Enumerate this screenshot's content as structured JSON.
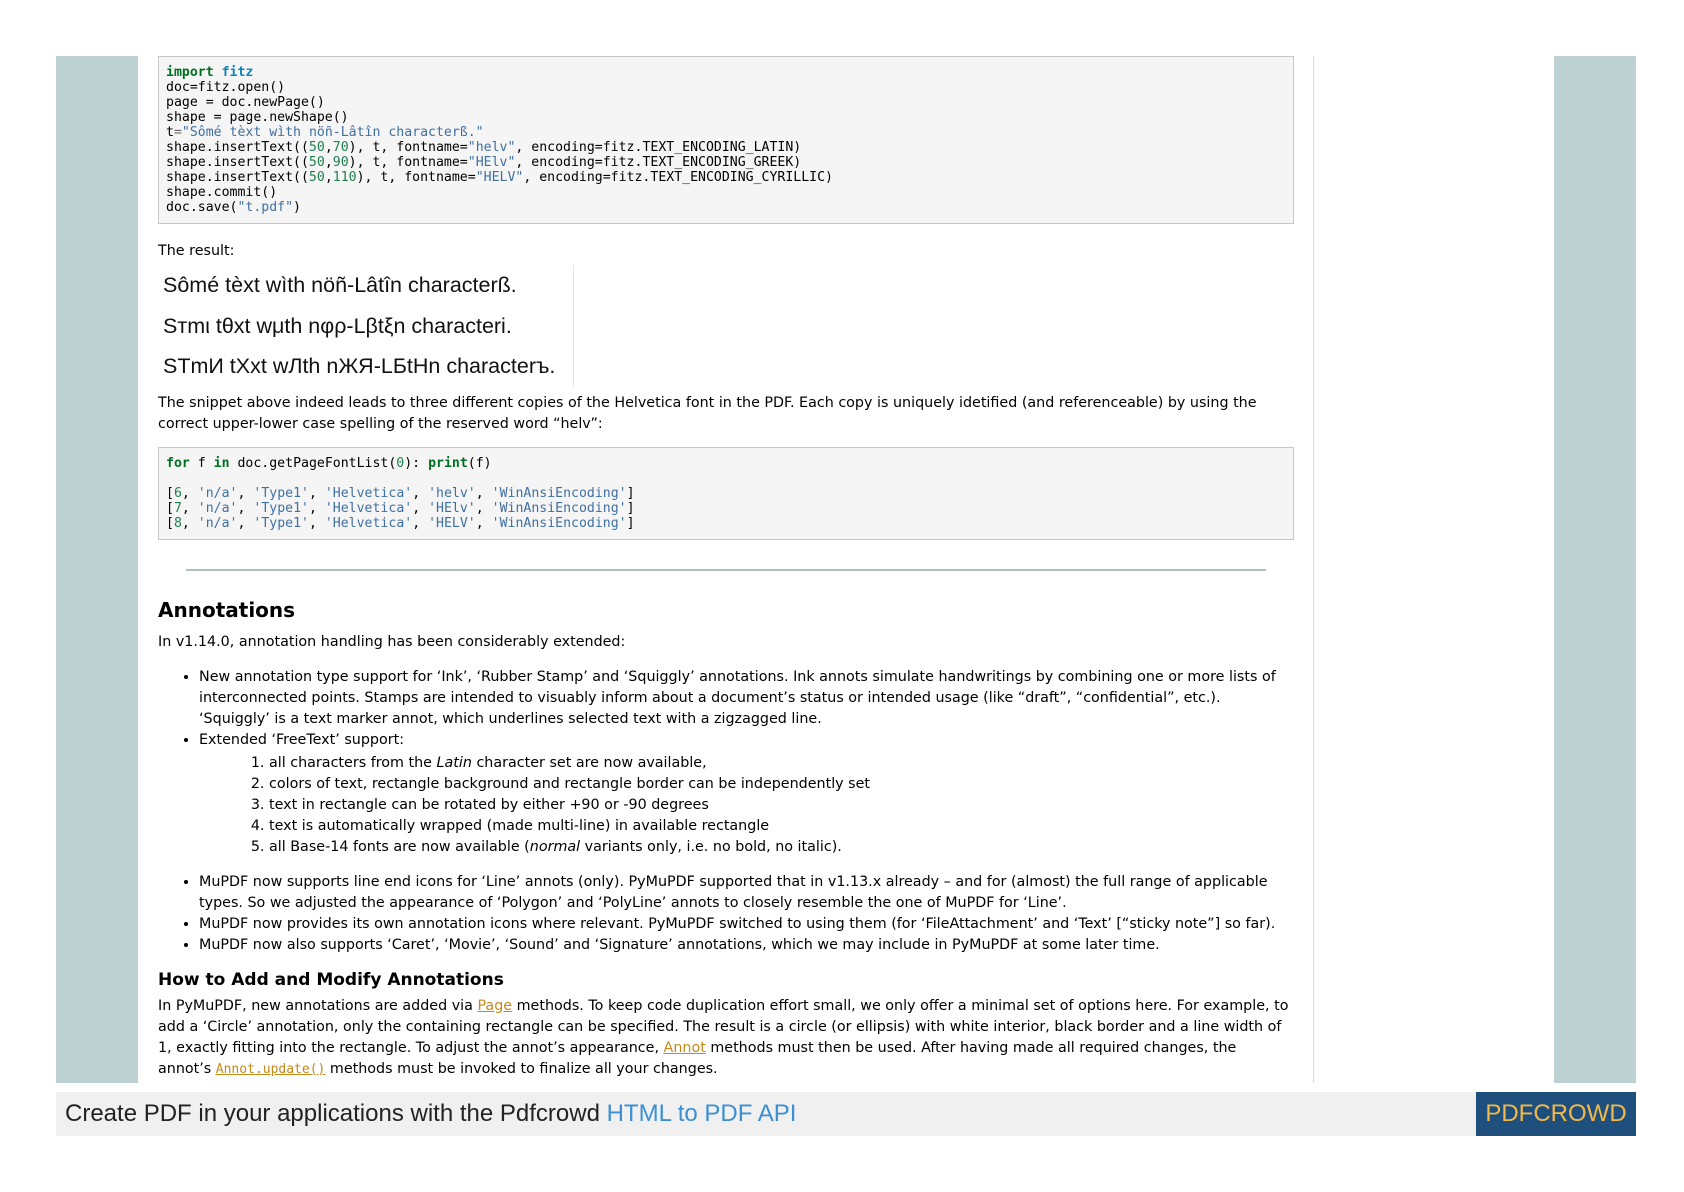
{
  "code1": {
    "kw_import": "import",
    "mod_fitz": "fitz",
    "l2": "doc=fitz.open()",
    "l3": "page = doc.newPage()",
    "l4": "shape = page.newShape()",
    "l5_var": "t",
    "l5_str": "\"Sômé tèxt wìth nöñ-Lâtîn characterß.\"",
    "ins_prefix": "shape.insertText((",
    "ins_sep": ",",
    "ins_mid": "), t, fontname=",
    "ins_enc": ", encoding=fitz.",
    "r1_x": "50",
    "r1_y": "70",
    "r1_font": "\"helv\"",
    "r1_enc": "TEXT_ENCODING_LATIN)",
    "r2_x": "50",
    "r2_y": "90",
    "r2_font": "\"HElv\"",
    "r2_enc": "TEXT_ENCODING_GREEK)",
    "r3_x": "50",
    "r3_y": "110",
    "r3_font": "\"HELV\"",
    "r3_enc": "TEXT_ENCODING_CYRILLIC)",
    "l9": "shape.commit()",
    "l10_pre": "doc.save(",
    "l10_str": "\"t.pdf\"",
    "l10_post": ")"
  },
  "result": {
    "label": "The result:",
    "lines": [
      "Sômé tèxt wìth nöñ-Lâtîn characterß.",
      "Sтmι tθxt wμth nφρ-Lβtξn characterі.",
      "STmИ tXxt wЛth nЖЯ-LБtHn characterъ."
    ]
  },
  "para_snippet": "The snippet above indeed leads to three different copies of the Helvetica font in the PDF. Each copy is uniquely idetified (and referenceable) by using the correct upper-lower case spelling of the reserved word “helv”:",
  "code2": {
    "kw_for": "for",
    "var_f": " f ",
    "kw_in": "in",
    "call": " doc.getPageFontList(",
    "zero": "0",
    "close": "): ",
    "kw_print": "print",
    "print_arg": "(f)",
    "rows": [
      {
        "num": "6",
        "name": "'helv'"
      },
      {
        "num": "7",
        "name": "'HElv'"
      },
      {
        "num": "8",
        "name": "'HELV'"
      }
    ],
    "row_na": "'n/a'",
    "row_type": "'Type1'",
    "row_font": "'Helvetica'",
    "row_enc": "'WinAnsiEncoding'"
  },
  "annotations": {
    "heading": "Annotations",
    "intro": "In v1.14.0, annotation handling has been considerably extended:",
    "bullet1": "New annotation type support for ‘Ink’, ‘Rubber Stamp’ and ‘Squiggly’ annotations. Ink annots simulate handwritings by combining one or more lists of interconnected points. Stamps are intended to visuably inform about a document’s status or intended usage (like “draft”, “confidential”, etc.). ‘Squiggly’ is a text marker annot, which underlines selected text with a zigzagged line.",
    "bullet2": "Extended ‘FreeText’ support:",
    "sub1_pre": "all characters from the ",
    "sub1_em": "Latin",
    "sub1_post": " character set are now available,",
    "sub2": "colors of text, rectangle background and rectangle border can be independently set",
    "sub3": "text in rectangle can be rotated by either +90 or -90 degrees",
    "sub4": "text is automatically wrapped (made multi-line) in available rectangle",
    "sub5_pre": "all Base-14 fonts are now available (",
    "sub5_em": "normal",
    "sub5_post": " variants only, i.e. no bold, no italic).",
    "bullet3": "MuPDF now supports line end icons for ‘Line’ annots (only). PyMuPDF supported that in v1.13.x already – and for (almost) the full range of applicable types. So we adjusted the appearance of ‘Polygon’ and ‘PolyLine’ annots to closely resemble the one of MuPDF for ‘Line’.",
    "bullet4": "MuPDF now provides its own annotation icons where relevant. PyMuPDF switched to using them (for ‘FileAttachment’ and ‘Text’ [“sticky note”] so far).",
    "bullet5": "MuPDF now also supports ‘Caret’, ‘Movie’, ‘Sound’ and ‘Signature’ annotations, which we may include in PyMuPDF at some later time."
  },
  "howto": {
    "heading": "How to Add and Modify Annotations",
    "p_a": "In PyMuPDF, new annotations are added via ",
    "link_page": "Page",
    "p_b": " methods. To keep code duplication effort small, we only offer a minimal set of options here. For example, to add a ‘Circle’ annotation, only the containing rectangle can be specified. The result is a circle (or ellipsis) with white interior, black border and a line width of 1, exactly fitting into the rectangle. To adjust the annot’s appearance, ",
    "link_annot": "Annot",
    "p_c": " methods must then be used. After having made all required changes, the annot’s ",
    "link_update": "Annot.update()",
    "p_d": " methods must be invoked to finalize all your changes."
  },
  "footer": {
    "text": "Create PDF in your applications with the Pdfcrowd ",
    "link": "HTML to PDF API",
    "brand": "PDFCROWD"
  }
}
